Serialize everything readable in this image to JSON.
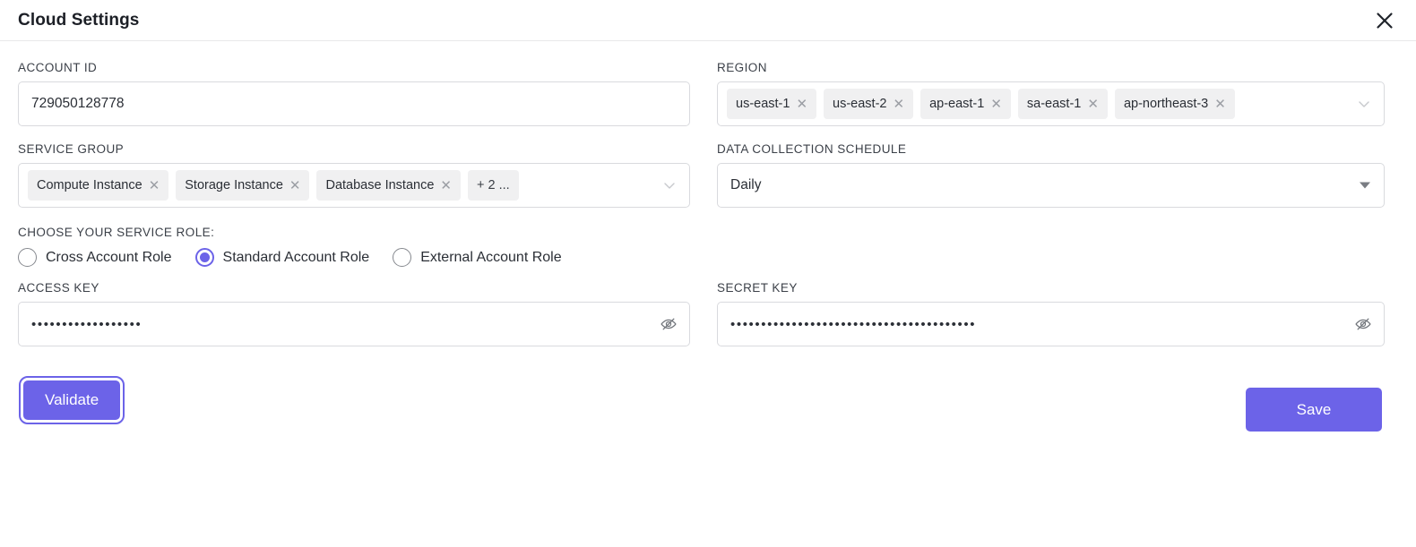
{
  "header": {
    "title": "Cloud Settings",
    "close_icon": "close-icon"
  },
  "form": {
    "account_id": {
      "label": "ACCOUNT ID",
      "value": "729050128778",
      "placeholder": "Account ID"
    },
    "region": {
      "label": "REGION",
      "tags": [
        {
          "label": "us-east-1",
          "remove": "✕"
        },
        {
          "label": "us-east-2",
          "remove": "✕"
        },
        {
          "label": "ap-east-1",
          "remove": "✕"
        },
        {
          "label": "sa-east-1",
          "remove": "✕"
        },
        {
          "label": "ap-northeast-3",
          "remove": "✕"
        }
      ],
      "chevron_icon": "chevron-down-icon"
    },
    "service_group": {
      "label": "SERVICE GROUP",
      "tags": [
        {
          "label": "Compute Instance",
          "remove": "✕"
        },
        {
          "label": "Storage Instance",
          "remove": "✕"
        },
        {
          "label": "Database Instance",
          "remove": "✕"
        }
      ],
      "overflow_label": "+ 2 ...",
      "chevron_icon": "chevron-down-icon"
    },
    "schedule": {
      "label": "DATA COLLECTION SCHEDULE",
      "value": "Daily",
      "options": [
        "Daily"
      ],
      "caret_icon": "caret-down-icon"
    },
    "service_role": {
      "label": "CHOOSE YOUR SERVICE ROLE:",
      "options": [
        {
          "label": "Cross Account Role",
          "selected": false
        },
        {
          "label": "Standard Account Role",
          "selected": true
        },
        {
          "label": "External Account Role",
          "selected": false
        }
      ]
    },
    "access_key": {
      "label": "ACCESS KEY",
      "value": "••••••••••••••••••",
      "toggle_icon": "eye-off-icon"
    },
    "secret_key": {
      "label": "SECRET KEY",
      "value": "••••••••••••••••••••••••••••••••••••••••",
      "toggle_icon": "eye-off-icon"
    }
  },
  "actions": {
    "validate_label": "Validate",
    "save_label": "Save"
  },
  "colors": {
    "accent": "#6c63e8",
    "border": "#d9dade",
    "tag_bg": "#f0f0f1",
    "text": "#2b2f36"
  }
}
